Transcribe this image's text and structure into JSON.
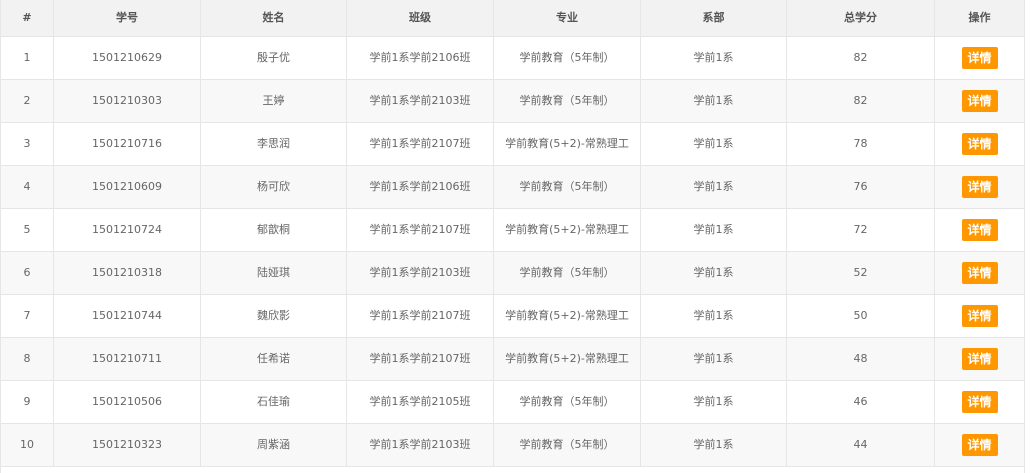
{
  "table": {
    "headers": [
      "#",
      "学号",
      "姓名",
      "班级",
      "专业",
      "系部",
      "总学分",
      "操作"
    ],
    "rows": [
      {
        "idx": "1",
        "sid": "1501210629",
        "name": "殷子优",
        "cls": "学前1系学前2106班",
        "major": "学前教育（5年制）",
        "dept": "学前1系",
        "credits": "82",
        "action": "详情"
      },
      {
        "idx": "2",
        "sid": "1501210303",
        "name": "王婷",
        "cls": "学前1系学前2103班",
        "major": "学前教育（5年制）",
        "dept": "学前1系",
        "credits": "82",
        "action": "详情"
      },
      {
        "idx": "3",
        "sid": "1501210716",
        "name": "李思润",
        "cls": "学前1系学前2107班",
        "major": "学前教育(5+2)-常熟理工",
        "dept": "学前1系",
        "credits": "78",
        "action": "详情"
      },
      {
        "idx": "4",
        "sid": "1501210609",
        "name": "杨可欣",
        "cls": "学前1系学前2106班",
        "major": "学前教育（5年制）",
        "dept": "学前1系",
        "credits": "76",
        "action": "详情"
      },
      {
        "idx": "5",
        "sid": "1501210724",
        "name": "郁歆桐",
        "cls": "学前1系学前2107班",
        "major": "学前教育(5+2)-常熟理工",
        "dept": "学前1系",
        "credits": "72",
        "action": "详情"
      },
      {
        "idx": "6",
        "sid": "1501210318",
        "name": "陆娅琪",
        "cls": "学前1系学前2103班",
        "major": "学前教育（5年制）",
        "dept": "学前1系",
        "credits": "52",
        "action": "详情"
      },
      {
        "idx": "7",
        "sid": "1501210744",
        "name": "魏欣影",
        "cls": "学前1系学前2107班",
        "major": "学前教育(5+2)-常熟理工",
        "dept": "学前1系",
        "credits": "50",
        "action": "详情"
      },
      {
        "idx": "8",
        "sid": "1501210711",
        "name": "任希诺",
        "cls": "学前1系学前2107班",
        "major": "学前教育(5+2)-常熟理工",
        "dept": "学前1系",
        "credits": "48",
        "action": "详情"
      },
      {
        "idx": "9",
        "sid": "1501210506",
        "name": "石佳瑜",
        "cls": "学前1系学前2105班",
        "major": "学前教育（5年制）",
        "dept": "学前1系",
        "credits": "46",
        "action": "详情"
      },
      {
        "idx": "10",
        "sid": "1501210323",
        "name": "周紫涵",
        "cls": "学前1系学前2103班",
        "major": "学前教育（5年制）",
        "dept": "学前1系",
        "credits": "44",
        "action": "详情"
      }
    ]
  },
  "colors": {
    "accent_button": "#ff9800",
    "header_bg": "#f2f2f2",
    "stripe_bg": "#f8f8f8",
    "border": "#e6e6e6"
  }
}
